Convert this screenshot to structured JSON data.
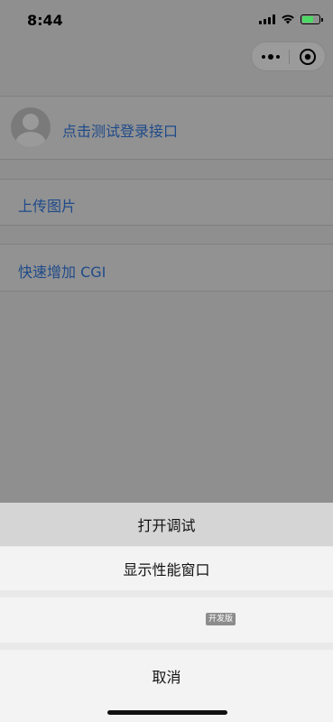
{
  "status_bar": {
    "time": "8:44"
  },
  "capsule": {
    "more_icon": "more-dots-icon",
    "close_icon": "target-circle-icon"
  },
  "page": {
    "login_text": "点击测试登录接口",
    "upload_text": "上传图片",
    "cgi_text": "快速增加 CGI"
  },
  "action_sheet": {
    "items": [
      "打开调试",
      "显示性能窗口"
    ],
    "version_badge": "开发版",
    "cancel": "取消"
  },
  "colors": {
    "link": "#1f4a8a",
    "battery": "#4cd964"
  }
}
